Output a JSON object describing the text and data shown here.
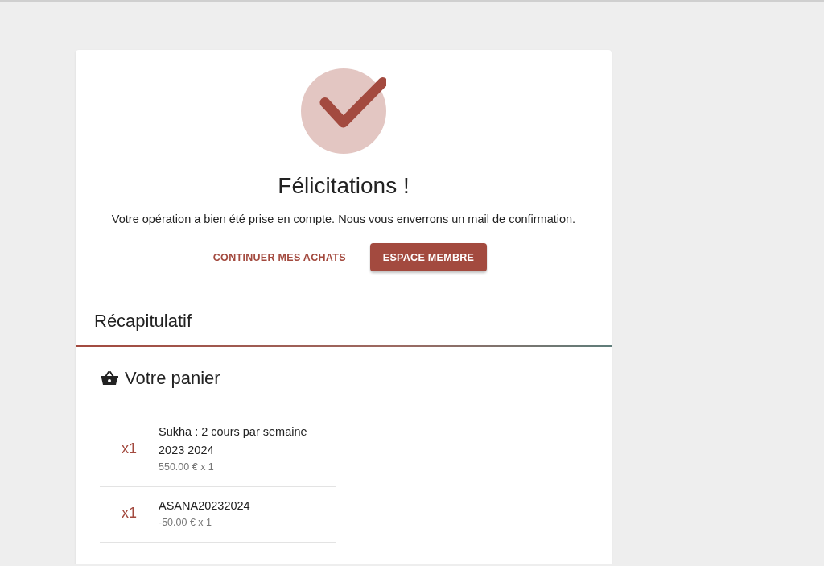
{
  "confirmation": {
    "title": "Félicitations !",
    "message": "Votre opération a bien été prise en compte. Nous vous enverrons un mail de confirmation.",
    "buttons": [
      {
        "label": "CONTINUER MES ACHATS",
        "kind": "text"
      },
      {
        "label": "ESPACE MEMBRE",
        "kind": "filled"
      }
    ]
  },
  "summary": {
    "title": "Récapitulatif"
  },
  "cart": {
    "title": "Votre panier",
    "items": [
      {
        "quantity": "x1",
        "name": "Sukha : 2 cours par semaine 2023 2024",
        "price": "550.00 € x 1"
      },
      {
        "quantity": "x1",
        "name": "ASANA20232024",
        "price": "-50.00 € x 1"
      }
    ]
  }
}
